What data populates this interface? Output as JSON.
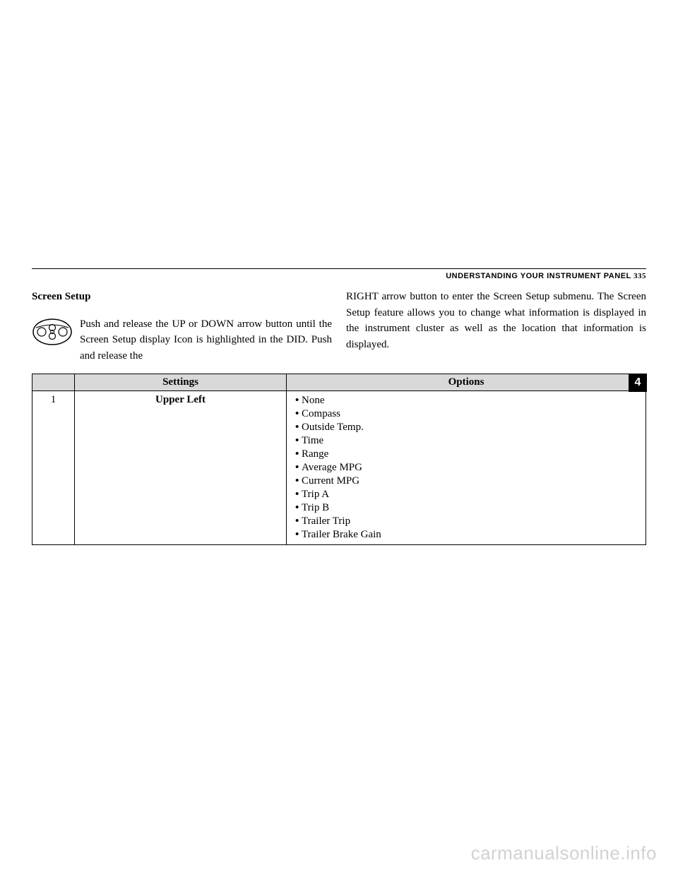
{
  "header": {
    "section": "UNDERSTANDING YOUR INSTRUMENT PANEL",
    "page_number": "335"
  },
  "section_title": "Screen Setup",
  "left_para": "Push and release the UP or DOWN arrow button until the Screen Setup display Icon is highlighted in the DID. Push and release the",
  "right_para": "RIGHT arrow button to enter the Screen Setup submenu. The Screen Setup feature allows you to change what information is displayed in the instrument cluster as well as the location that information is displayed.",
  "table": {
    "headers": {
      "col2": "Settings",
      "col3": "Options"
    },
    "row": {
      "num": "1",
      "setting": "Upper Left",
      "options": [
        "None",
        "Compass",
        "Outside Temp.",
        "Time",
        "Range",
        "Average MPG",
        "Current MPG",
        "Trip A",
        "Trip B",
        "Trailer Trip",
        "Trailer Brake Gain"
      ]
    }
  },
  "side_tab": "4",
  "watermark": "carmanualsonline.info"
}
